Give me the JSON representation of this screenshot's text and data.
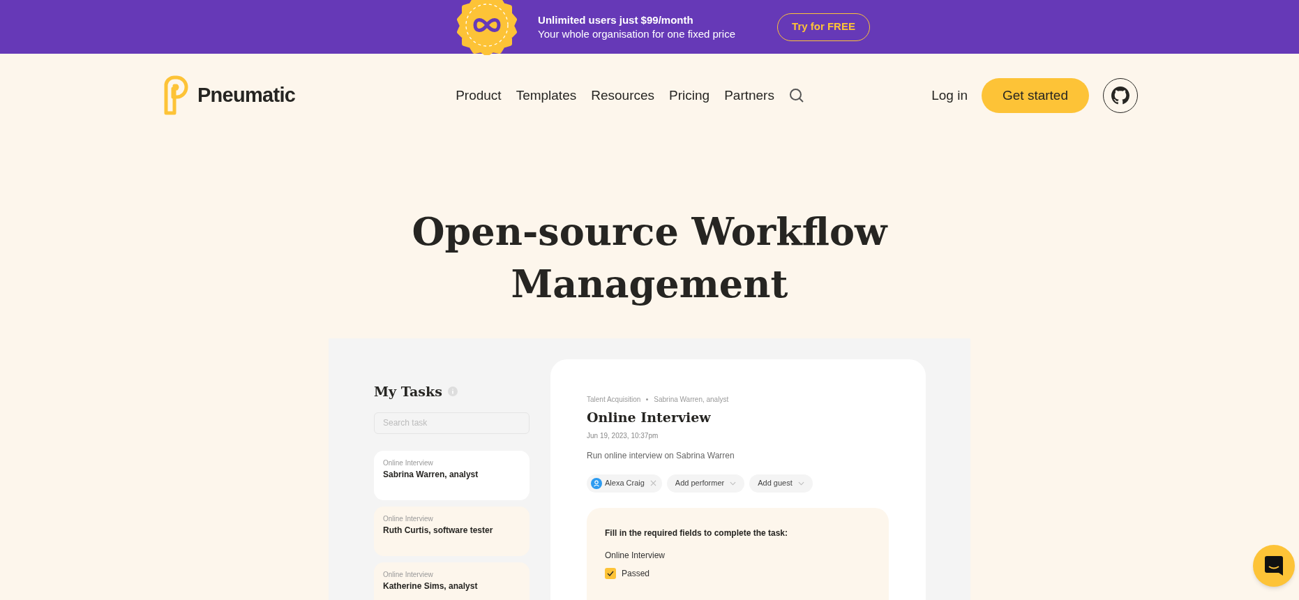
{
  "promo_banner": {
    "headline": "Unlimited users just $99/month",
    "subtitle": "Your whole organisation for one fixed price",
    "button": "Try for FREE"
  },
  "header": {
    "logo": "Pneumatic",
    "nav": [
      "Product",
      "Templates",
      "Resources",
      "Pricing",
      "Partners"
    ],
    "login": "Log in",
    "cta": "Get started"
  },
  "hero": {
    "title_lines": [
      "Open-source Workflow",
      "Management"
    ]
  },
  "app_preview": {
    "sidebar": {
      "title": "My Tasks",
      "search": {
        "placeholder": "Search task"
      },
      "tasks": [
        {
          "template": "Online Interview",
          "name": "Sabrina Warren, analyst",
          "selected": true
        },
        {
          "template": "Online Interview",
          "name": "Ruth Curtis, software tester",
          "selected": false
        },
        {
          "template": "Online Interview",
          "name": "Katherine Sims, analyst",
          "selected": false
        }
      ]
    },
    "task": {
      "breadcrumb": [
        "Talent Acquisition",
        "Sabrina Warren, analyst"
      ],
      "title": "Online Interview",
      "date": "Jun 19, 2023, 10:37pm",
      "description": "Run online interview on Sabrina Warren",
      "chips": [
        {
          "kind": "person",
          "label": "Alexa Craig"
        },
        {
          "kind": "dropdown",
          "label": "Add performer"
        },
        {
          "kind": "dropdown",
          "label": "Add guest"
        }
      ],
      "form": {
        "heading": "Fill in the required fields to complete the task:",
        "field_label": "Online Interview",
        "checkbox": {
          "label": "Passed",
          "checked": true
        }
      }
    }
  }
}
